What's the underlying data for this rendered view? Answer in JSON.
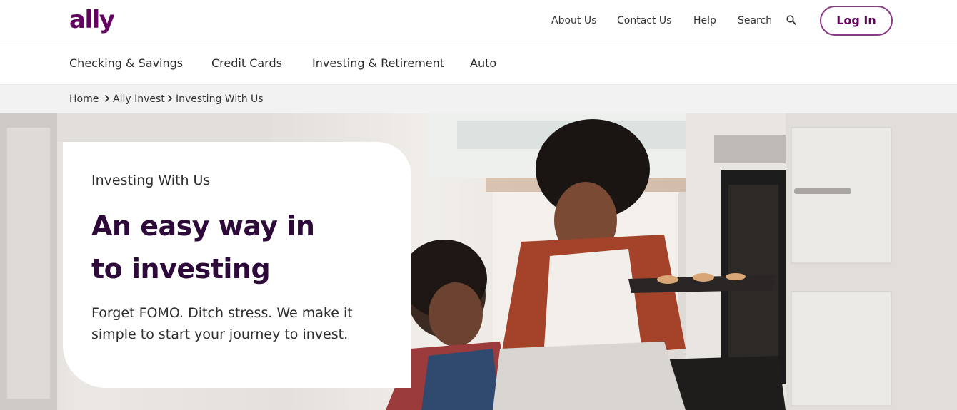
{
  "brand": {
    "logo_text": "ally",
    "color": "#650360"
  },
  "utility_nav": {
    "items": [
      "About Us",
      "Contact Us",
      "Help",
      "Search"
    ],
    "search_icon": "search-icon",
    "login_label": "Log In"
  },
  "main_nav": {
    "items": [
      "Checking & Savings",
      "Credit Cards",
      "Investing & Retirement",
      "Auto"
    ]
  },
  "breadcrumb": {
    "items": [
      "Home",
      "Ally Invest",
      "Investing With Us"
    ],
    "separator_icon": "chevron-right-icon"
  },
  "hero": {
    "eyebrow": "Investing With Us",
    "headline_line1": "An easy way in",
    "headline_line2": "to investing",
    "subcopy": "Forget FOMO. Ditch stress. We make it simple to start your journey to invest.",
    "heading_color": "#2e0a3b",
    "image_subject": "mother and child baking at oven"
  }
}
